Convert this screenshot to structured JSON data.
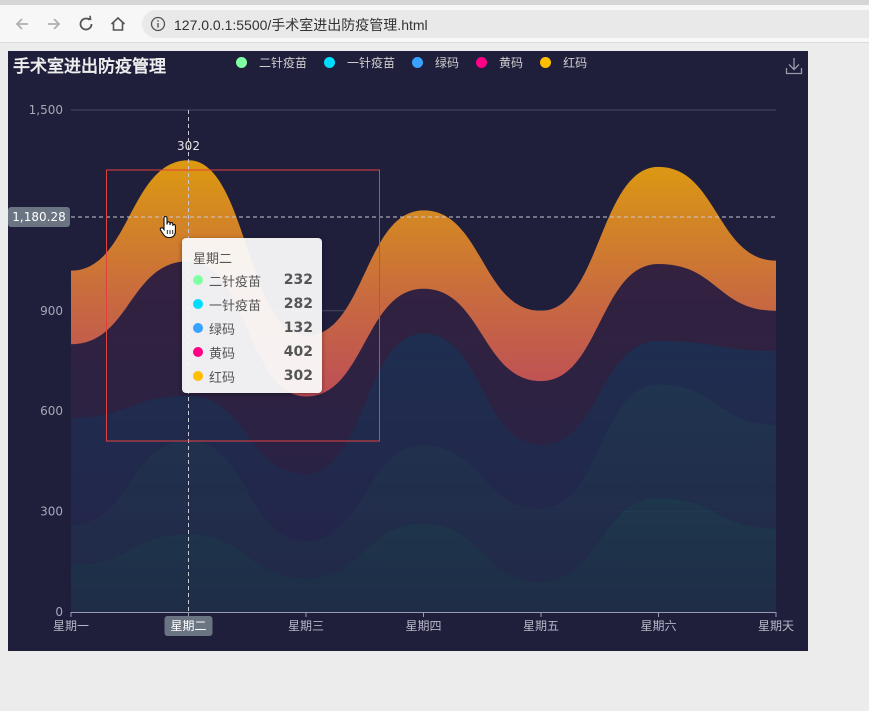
{
  "browser": {
    "url": "127.0.0.1:5500/手术室进出防疫管理.html"
  },
  "chart": {
    "title": "手术室进出防疫管理",
    "crosshair_value": "1,180.28",
    "peak_label": "302",
    "highlight_category": "星期二"
  },
  "tooltip": {
    "title": "星期二",
    "rows": [
      {
        "name": "二针疫苗",
        "value": "232",
        "color": "#80ffa5"
      },
      {
        "name": "一针疫苗",
        "value": "282",
        "color": "#00ddff"
      },
      {
        "name": "绿码",
        "value": "132",
        "color": "#37a2ff"
      },
      {
        "name": "黄码",
        "value": "402",
        "color": "#ff0087"
      },
      {
        "name": "红码",
        "value": "302",
        "color": "#ffbf00"
      }
    ]
  },
  "chart_data": {
    "type": "area",
    "stacked": true,
    "smooth": true,
    "title": "手术室进出防疫管理",
    "categories": [
      "星期一",
      "星期二",
      "星期三",
      "星期四",
      "星期五",
      "星期六",
      "星期天"
    ],
    "ylim": [
      0,
      1500
    ],
    "yticks": [
      "0",
      "300",
      "600",
      "900",
      "1,500"
    ],
    "legend_position": "top-center",
    "grid": true,
    "series": [
      {
        "name": "二针疫苗",
        "color": "#80ffa5",
        "values": [
          140,
          232,
          101,
          264,
          90,
          340,
          250
        ]
      },
      {
        "name": "一针疫苗",
        "color": "#00ddff",
        "values": [
          120,
          282,
          111,
          234,
          220,
          340,
          310
        ]
      },
      {
        "name": "绿码",
        "color": "#37a2ff",
        "values": [
          320,
          132,
          201,
          334,
          190,
          130,
          220
        ]
      },
      {
        "name": "黄码",
        "color": "#ff0087",
        "values": [
          220,
          402,
          231,
          134,
          190,
          230,
          120
        ]
      },
      {
        "name": "红码",
        "color": "#ffbf00",
        "values": [
          220,
          302,
          181,
          234,
          210,
          290,
          150
        ]
      }
    ]
  }
}
